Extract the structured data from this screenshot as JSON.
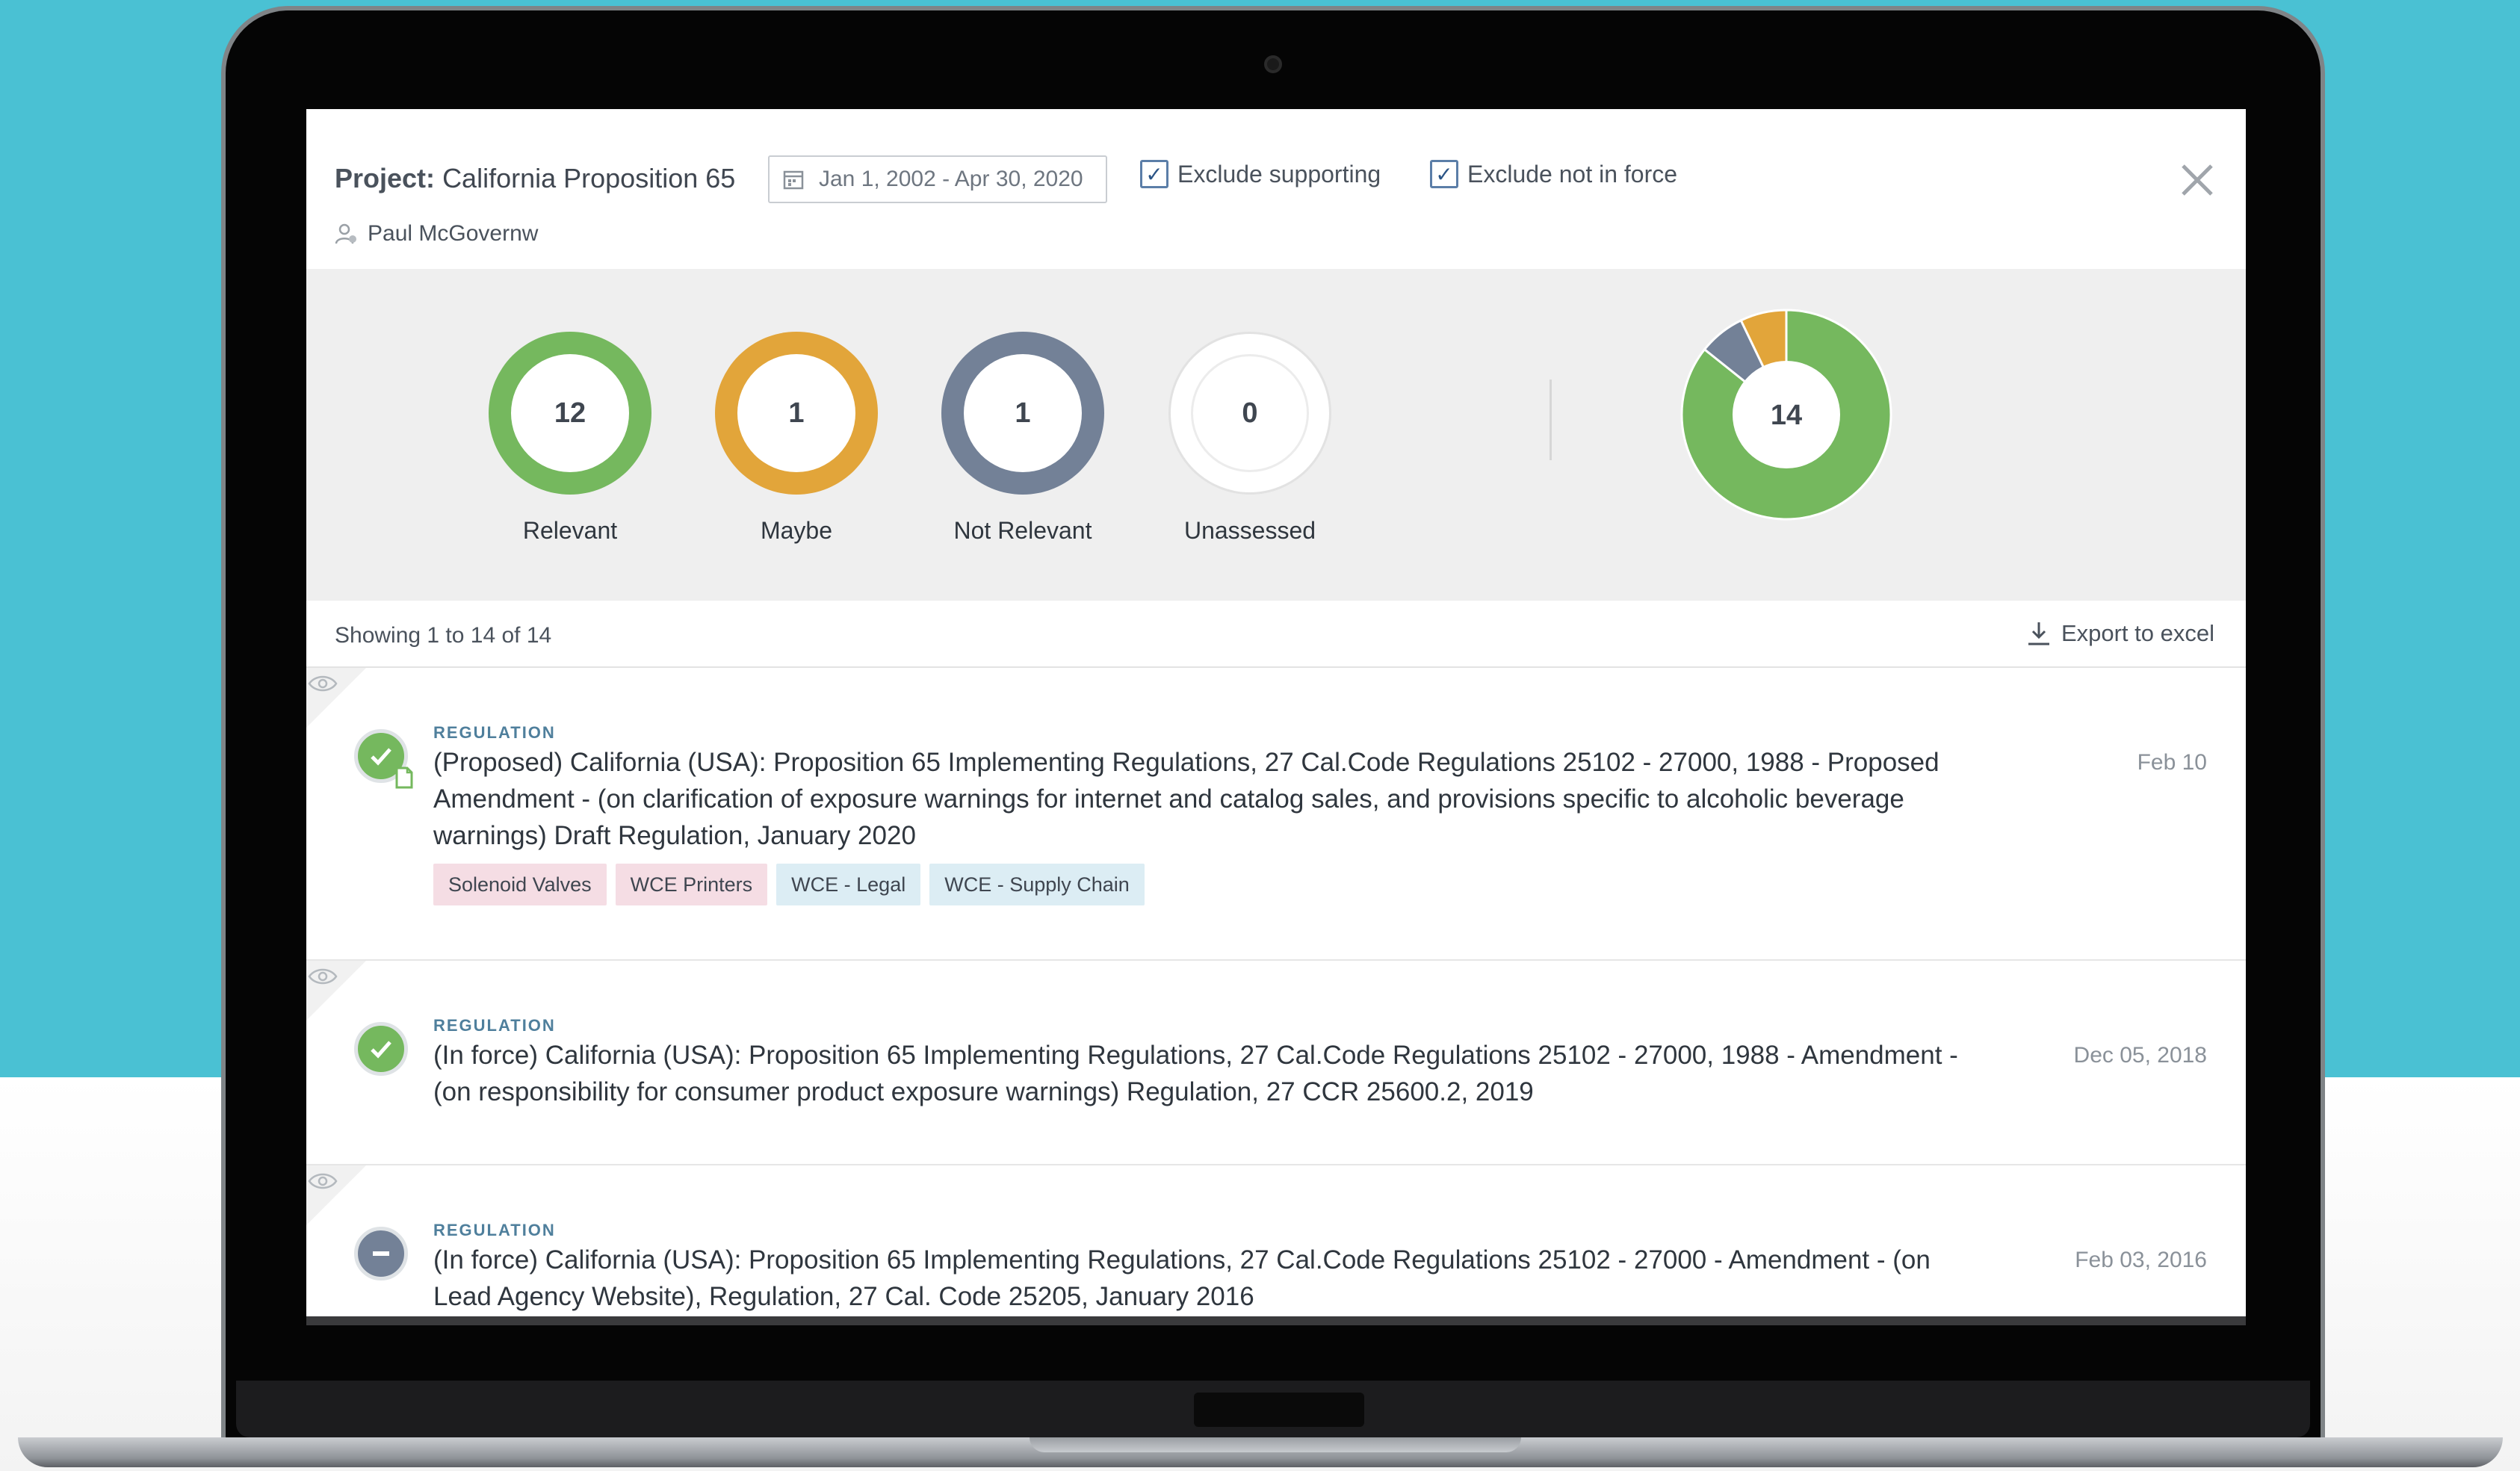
{
  "header": {
    "project_label": "Project:",
    "project_name": "California Proposition 65",
    "date_range": "Jan 1, 2002 - Apr 30, 2020",
    "exclude_supporting": "Exclude supporting",
    "exclude_not_in_force": "Exclude not in force",
    "user": "Paul McGovernw"
  },
  "summary": {
    "relevant": {
      "count": "12",
      "label": "Relevant",
      "color": "#75b85e"
    },
    "maybe": {
      "count": "1",
      "label": "Maybe",
      "color": "#e2a53a"
    },
    "not_relevant": {
      "count": "1",
      "label": "Not Relevant",
      "color": "#738197"
    },
    "unassessed": {
      "count": "0",
      "label": "Unassessed",
      "color": "#ffffff"
    },
    "total": "14"
  },
  "chart_data": {
    "type": "pie",
    "categories": [
      "Relevant",
      "Maybe",
      "Not Relevant",
      "Unassessed"
    ],
    "values": [
      12,
      1,
      1,
      0
    ],
    "colors": [
      "#75b85e",
      "#e2a53a",
      "#738197",
      "#ffffff"
    ]
  },
  "list": {
    "showing": "Showing 1 to 14 of 14",
    "export_label": "Export to excel",
    "items": [
      {
        "kind": "REGULATION",
        "title": "(Proposed) California (USA): Proposition 65 Implementing Regulations, 27 Cal.Code Regulations 25102 - 27000, 1988 - Proposed Amendment - (on clarification of exposure warnings for internet and catalog sales, and provisions specific to alcoholic beverage warnings) Draft Regulation, January 2020",
        "date": "Feb 10",
        "tags": [
          "Solenoid Valves",
          "WCE Printers",
          "WCE - Legal",
          "WCE - Supply Chain"
        ]
      },
      {
        "kind": "REGULATION",
        "title": "(In force) California (USA): Proposition 65 Implementing Regulations, 27 Cal.Code Regulations 25102 - 27000, 1988 - Amendment - (on responsibility for consumer product exposure warnings) Regulation, 27 CCR 25600.2, 2019",
        "date": "Dec 05, 2018"
      },
      {
        "kind": "REGULATION",
        "title": "(In force) California (USA): Proposition 65 Implementing Regulations, 27 Cal.Code Regulations 25102 - 27000 - Amendment - (on Lead Agency Website), Regulation, 27 Cal. Code 25205, January 2016",
        "date": "Feb 03, 2016"
      }
    ]
  }
}
